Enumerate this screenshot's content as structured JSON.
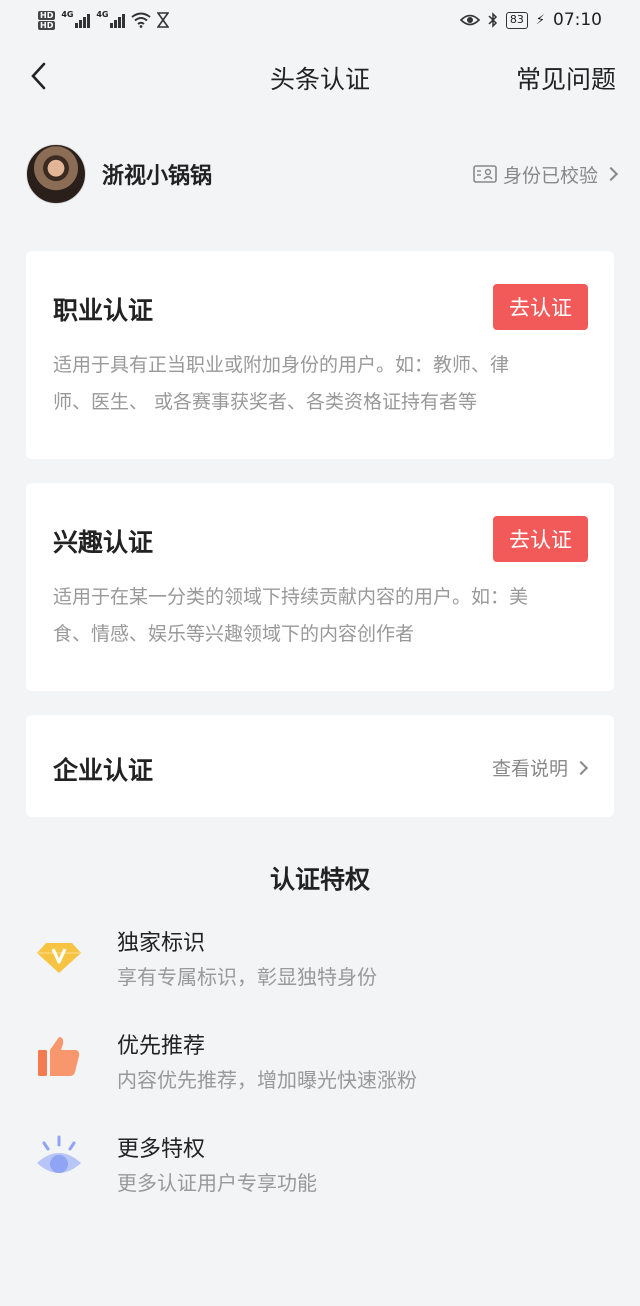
{
  "status_bar": {
    "hd1": "HD",
    "hd2": "HD",
    "net1": "4G",
    "net2": "4G",
    "battery": "83",
    "time": "07:10"
  },
  "nav": {
    "title": "头条认证",
    "faq": "常见问题"
  },
  "profile": {
    "name": "浙视小锅锅",
    "verified_label": "身份已校验"
  },
  "cards": [
    {
      "title": "职业认证",
      "button": "去认证",
      "desc_line1": "适用于具有正当职业或附加身份的用户。如：教师、律",
      "desc_line2": "师、医生、 或各赛事获奖者、各类资格证持有者等"
    },
    {
      "title": "兴趣认证",
      "button": "去认证",
      "desc_line1": "适用于在某一分类的领域下持续贡献内容的用户。如：美",
      "desc_line2": "食、情感、娱乐等兴趣领域下的内容创作者"
    },
    {
      "title": "企业认证",
      "link": "查看说明"
    }
  ],
  "privileges": {
    "title": "认证特权",
    "items": [
      {
        "name": "独家标识",
        "desc": "享有专属标识，彰显独特身份",
        "icon": "diamond-v-icon",
        "color": "#f6c342"
      },
      {
        "name": "优先推荐",
        "desc": "内容优先推荐，增加曝光快速涨粉",
        "icon": "thumbs-up-icon",
        "color": "#f47a4f"
      },
      {
        "name": "更多特权",
        "desc": "更多认证用户专享功能",
        "icon": "eye-icon",
        "color": "#8fa4f2"
      }
    ]
  },
  "colors": {
    "accent": "#f25a5a",
    "background": "#f3f4f6"
  }
}
